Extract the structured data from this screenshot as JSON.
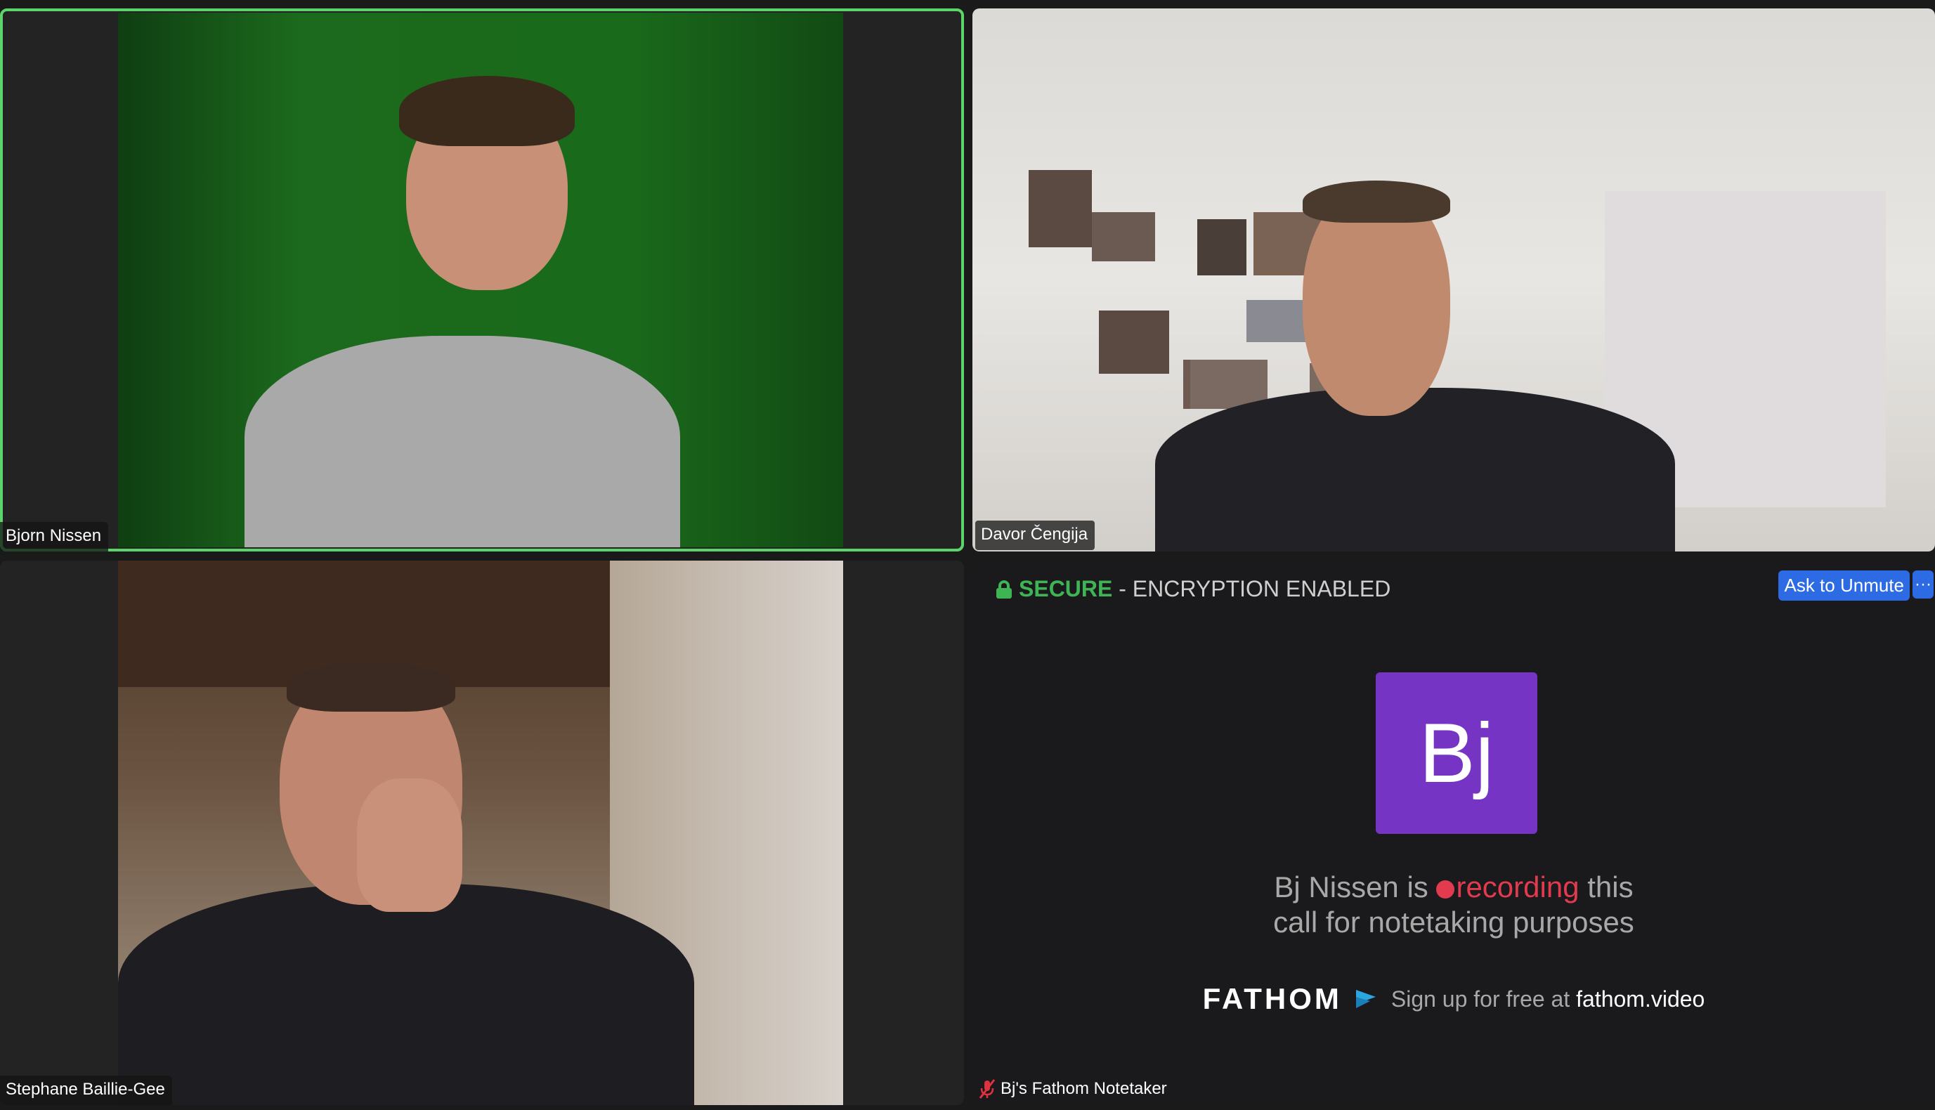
{
  "participants": [
    {
      "name": "Bjorn Nissen",
      "active_speaker": true
    },
    {
      "name": "Davor Čengija",
      "active_speaker": false
    },
    {
      "name": "Stephane Baillie-Gee",
      "active_speaker": false
    },
    {
      "name": "Bj's Fathom Notetaker",
      "active_speaker": false,
      "muted": true
    }
  ],
  "encryption": {
    "secure_label": "SECURE",
    "separator": " - ",
    "status": "ENCRYPTION ENABLED"
  },
  "controls": {
    "ask_to_unmute": "Ask to Unmute",
    "more": "···"
  },
  "notetaker": {
    "avatar_initials": "Bj",
    "line1_prefix": "Bj Nissen is ",
    "recording_word": "recording",
    "line1_suffix": " this",
    "line2": "call for notetaking purposes",
    "brand": "FATHOM",
    "signup_text": "Sign up for free at ",
    "signup_url": "fathom.video"
  },
  "colors": {
    "active_border": "#5dd46a",
    "secure_green": "#3fb454",
    "button_blue": "#2d6be4",
    "avatar_purple": "#7534c4",
    "recording_red": "#e23a4e"
  },
  "icons": [
    "lock-icon",
    "recording-dot-icon",
    "fathom-logo-icon",
    "mic-off-icon",
    "more-icon"
  ]
}
